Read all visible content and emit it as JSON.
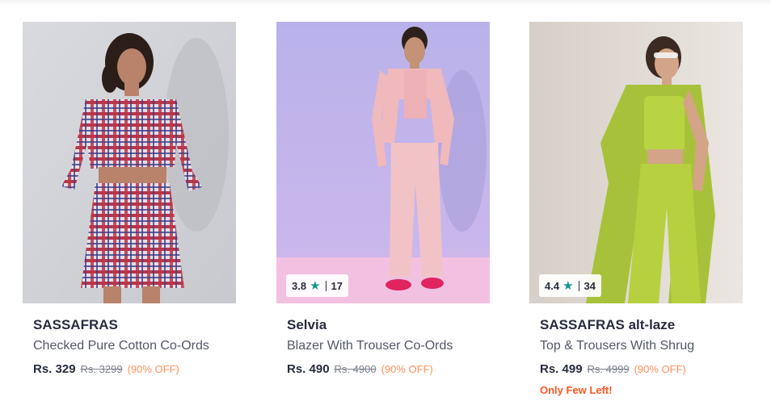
{
  "products": [
    {
      "brand": "SASSAFRAS",
      "name": "Checked Pure Cotton Co-Ords",
      "price": "Rs. 329",
      "mrp": "Rs. 3299",
      "discount": "(90% OFF)",
      "image_alt": "Model wearing red checked crop shirt and pleated skirt"
    },
    {
      "brand": "Selvia",
      "name": "Blazer With Trouser Co-Ords",
      "price": "Rs. 490",
      "mrp": "Rs. 4900",
      "discount": "(90% OFF)",
      "rating": "3.8",
      "rating_count": "17",
      "image_alt": "Model wearing pink blazer and trousers on lilac background"
    },
    {
      "brand": "SASSAFRAS alt-laze",
      "name": "Top & Trousers With Shrug",
      "price": "Rs. 499",
      "mrp": "Rs. 4999",
      "discount": "(90% OFF)",
      "rating": "4.4",
      "rating_count": "34",
      "stock_note": "Only Few Left!",
      "image_alt": "Model wearing lime green top, trousers and long shrug"
    }
  ],
  "icons": {
    "rating": "star-icon"
  },
  "colors": {
    "brand_text": "#282c3f",
    "product_text": "#535766",
    "discount": "#ff905a",
    "stock_warning": "#ff5722",
    "rating_star": "#14958f"
  }
}
